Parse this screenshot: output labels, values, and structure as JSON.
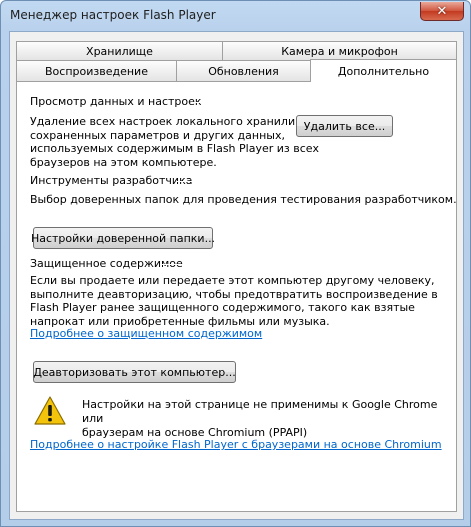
{
  "window": {
    "title": "Менеджер настроек Flash Player",
    "close_symbol": "✕"
  },
  "tabs": {
    "row_top": [
      {
        "label": "Хранилище"
      },
      {
        "label": "Камера и микрофон"
      }
    ],
    "row_bottom": [
      {
        "label": "Воспроизведение"
      },
      {
        "label": "Обновления"
      },
      {
        "label": "Дополнительно",
        "active": true
      }
    ]
  },
  "sections": {
    "browsing": {
      "title": "Просмотр данных и настроек",
      "description_lines": [
        "Удаление всех настроек локального хранилища,",
        "сохраненных параметров и других данных,",
        "используемых содержимым в Flash Player из всех",
        "браузеров на этом компьютере."
      ],
      "button_label": "Удалить все..."
    },
    "developer": {
      "title": "Инструменты разработчика",
      "description": "Выбор доверенных папок для проведения тестирования разработчиком.",
      "button_label": "Настройки доверенной папки..."
    },
    "protected": {
      "title": "Защищенное содержимое",
      "description_lines": [
        "Если вы продаете или передаете этот компьютер другому человеку,",
        "выполните деавторизацию, чтобы предотвратить воспроизведение в",
        "Flash Player ранее защищенного содержимого, такого как взятые",
        "напрокат или приобретенные фильмы или музыка."
      ],
      "link_label": "Подробнее о защищенном содержимом",
      "button_label": "Деавторизовать этот компьютер..."
    },
    "notice": {
      "text_lines": [
        "Настройки на этой странице не применимы к Google Chrome или",
        "браузерам на основе Chromium (PPAPI)"
      ],
      "link_label": "Подробнее о настройке Flash Player с браузерами на основе Chromium"
    }
  },
  "colors": {
    "link": "#0066cc",
    "warning_fill": "#f4c30b",
    "warning_outline": "#8a6d00"
  }
}
